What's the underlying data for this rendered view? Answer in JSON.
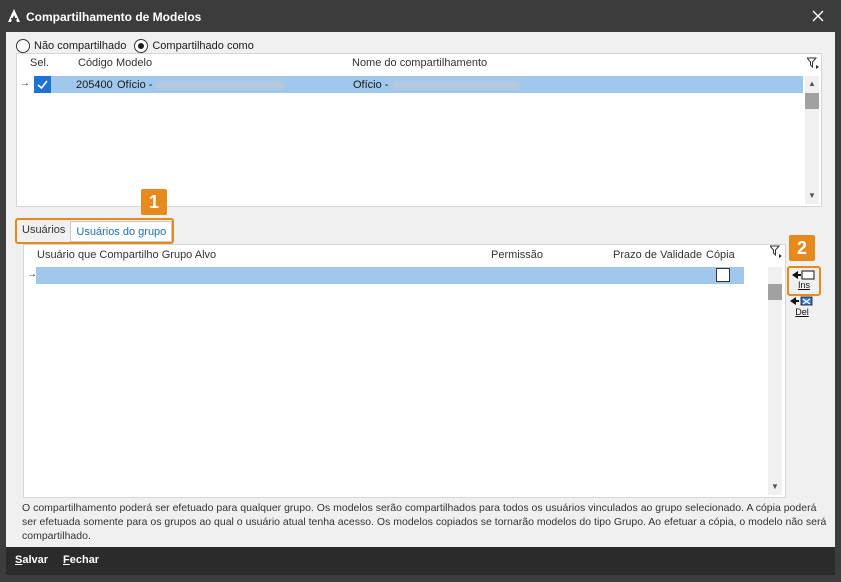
{
  "window": {
    "title": "Compartilhamento de Modelos"
  },
  "sharing_mode": {
    "options": [
      {
        "label": "Não compartilhado",
        "selected": false
      },
      {
        "label": "Compartilhado como",
        "selected": true
      }
    ]
  },
  "models_grid": {
    "columns": {
      "sel": "Sel.",
      "codigo": "Código",
      "modelo": "Modelo",
      "nome": "Nome do compartilhamento"
    },
    "rows": [
      {
        "selected": true,
        "codigo": "205400",
        "modelo": "Ofício -",
        "nome": "Ofício -"
      }
    ]
  },
  "tabs": [
    {
      "label": "Usuários",
      "active": false
    },
    {
      "label": "Usuários do grupo",
      "active": true
    }
  ],
  "users_grid": {
    "columns": {
      "usuario": "Usuário que Compartilho Grupo Alvo",
      "permissao": "Permissão",
      "prazo": "Prazo de Validade",
      "copia": "Cópia"
    }
  },
  "side_buttons": {
    "insert": "Ins",
    "delete": "Del"
  },
  "annotations": {
    "badge1": "1",
    "badge2": "2"
  },
  "info_text": "O compartilhamento poderá ser efetuado para qualquer grupo. Os modelos serão compartilhados para todos os usuários vinculados ao grupo selecionado. A cópia poderá ser efetuada somente para os grupos ao qual o usuário atual tenha acesso. Os modelos copiados se tornarão modelos do tipo Grupo. Ao efetuar a cópia, o modelo não será compartilhado.",
  "footer": {
    "save": "Salvar",
    "close": "Fechar"
  },
  "colors": {
    "accent_orange": "#e68a1e",
    "selection": "#9fc8ec",
    "titlebar": "#3c3c3c",
    "tab_active_text": "#1f6cb3"
  }
}
